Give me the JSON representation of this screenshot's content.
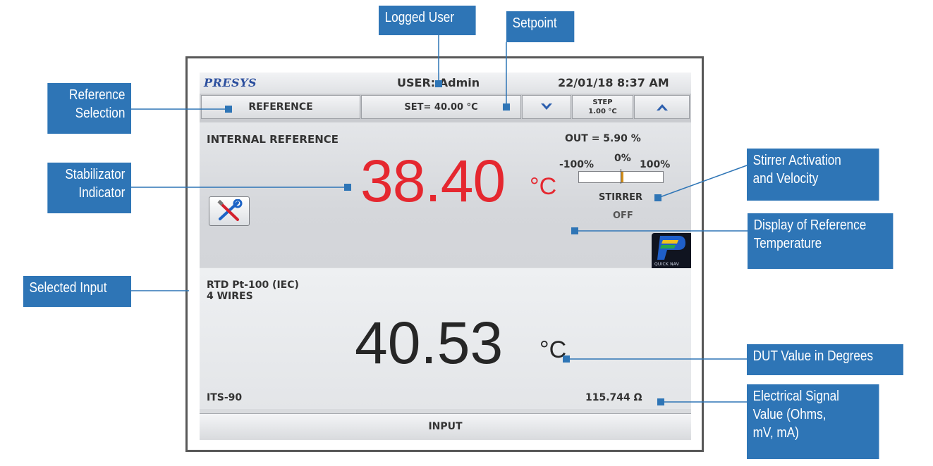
{
  "device": {
    "brand": "PRESYS",
    "user": "USER: Admin",
    "datetime": "22/01/18  8:37 AM",
    "toolbar": {
      "reference_label": "REFERENCE",
      "setpoint_label": "SET= 40.00 °C",
      "decrease_icon": "chevron-down-icon",
      "step_title": "STEP",
      "step_value": "1.00 °C",
      "increase_icon": "chevron-up-icon"
    },
    "reference": {
      "title": "INTERNAL REFERENCE",
      "out_text": "OUT = 5.90 %",
      "out_percent": 5.9,
      "scale_min": "-100%",
      "scale_mid": "0%",
      "scale_max": "100%",
      "value": "38.40",
      "unit": "°C",
      "stirrer_label": "STIRRER",
      "stirrer_state": "OFF",
      "tools_icon": "tools-icon",
      "quicknav_label": "QUICK NAV"
    },
    "input": {
      "sensor": "RTD Pt-100 (IEC)",
      "wires": "4 WIRES",
      "value": "40.53",
      "unit": "°C",
      "scale": "ITS-90",
      "electrical": "115.744 Ω",
      "tab_label": "INPUT"
    }
  },
  "callouts": {
    "logged_user": "Logged User",
    "setpoint": "Setpoint",
    "reference_selection": [
      "Reference",
      "Selection"
    ],
    "stabilizator_indicator": [
      "Stabilizator",
      "Indicator"
    ],
    "selected_input": "Selected Input",
    "stirrer": [
      "Stirrer Activation",
      "and Velocity"
    ],
    "display_reference": [
      "Display of Reference",
      "Temperature"
    ],
    "dut_value": "DUT Value in Degrees",
    "electrical_signal": [
      "Electrical Signal",
      "Value (Ohms,",
      "mV, mA)"
    ]
  },
  "colors": {
    "callout_blue": "#2e75b6",
    "reference_red": "#e5272f",
    "brand_blue": "#2c4f9e"
  }
}
